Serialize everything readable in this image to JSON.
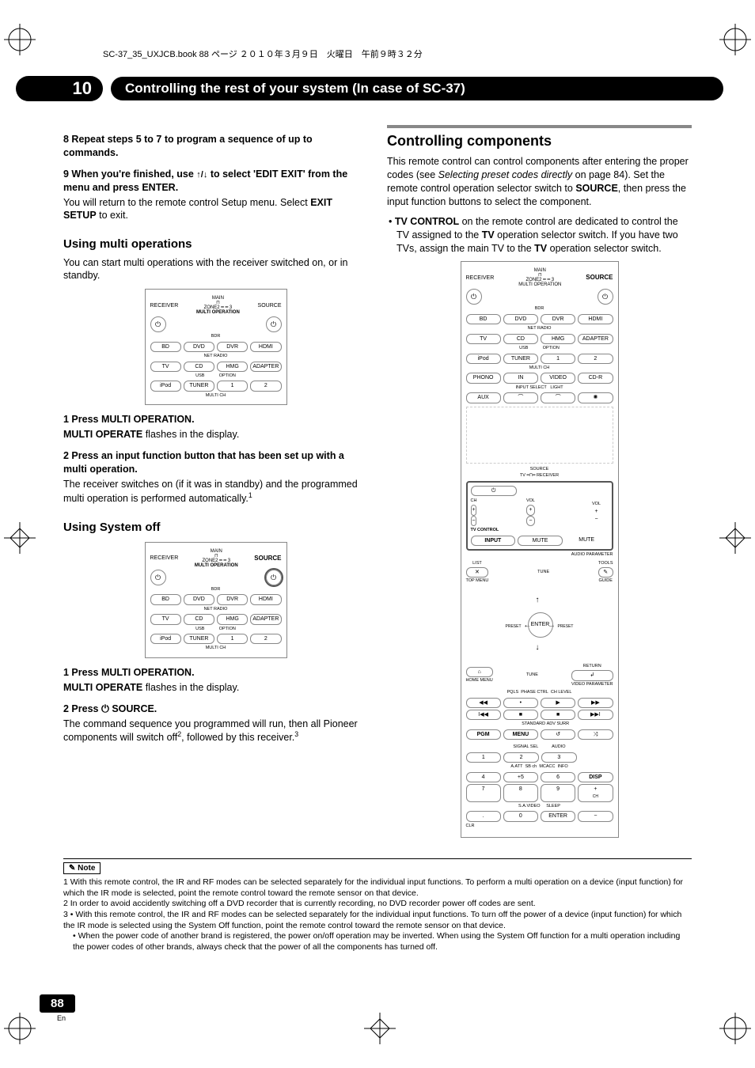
{
  "header": "SC-37_35_UXJCB.book  88 ページ  ２０１０年３月９日　火曜日　午前９時３２分",
  "chapter_num": "10",
  "chapter_title": "Controlling the rest of your system (In case of SC-37)",
  "col1": {
    "step8": "8   Repeat steps 5 to 7 to program a sequence of up to commands.",
    "step9_a": "9   When you're finished, use ",
    "step9_b": " to select 'EDIT EXIT' from the menu and press ENTER.",
    "step9_body_a": "You will return to the remote control Setup menu. Select ",
    "step9_body_b": "EXIT SETUP",
    "step9_body_c": " to exit.",
    "h_multi": "Using multi operations",
    "multi_body": "You can start multi operations with the receiver switched on, or in standby.",
    "multi_s1": "1   Press MULTI OPERATION.",
    "multi_s1_body_a": "MULTI OPERATE",
    "multi_s1_body_b": " flashes in the display.",
    "multi_s2": "2   Press an input function button that has been set up with a multi operation.",
    "multi_s2_body": "The receiver switches on (if it was in standby) and the programmed multi operation is performed automatically.",
    "h_sysoff": "Using System off",
    "sys_s1": "1   Press MULTI OPERATION.",
    "sys_s1_body_a": "MULTI OPERATE",
    "sys_s1_body_b": " flashes in the display.",
    "sys_s2_a": "2   Press ",
    "sys_s2_b": " SOURCE.",
    "sys_s2_body_a": "The command sequence you programmed will run, then all Pioneer components will switch off",
    "sys_s2_body_b": ", followed by this receiver."
  },
  "col2": {
    "h_main": "Controlling components",
    "intro_a": "This remote control can control components after entering the proper codes (see ",
    "intro_i": "Selecting preset codes directly",
    "intro_b": " on page 84). Set the remote control operation selector switch to ",
    "intro_bold": "SOURCE",
    "intro_c": ", then press the input function buttons to select the component.",
    "bullet_a": "TV CONTROL",
    "bullet_b": " on the remote control are dedicated to control the TV assigned to the ",
    "bullet_c": "TV",
    "bullet_d": " operation selector switch. If you have two TVs, assign the main TV to the ",
    "bullet_e": "TV",
    "bullet_f": " operation selector switch."
  },
  "remote": {
    "receiver": "RECEIVER",
    "main": "MAIN",
    "source": "SOURCE",
    "zone2": "ZONE2",
    "multi_op": "MULTI OPERATION",
    "bdr": "BDR",
    "row1": [
      "BD",
      "DVD",
      "DVR",
      "HDMI"
    ],
    "netradio": "NET RADIO",
    "row2": [
      "TV",
      "CD",
      "HMG",
      "ADAPTER"
    ],
    "usb": "USB",
    "option": "OPTION",
    "row3": [
      "iPod",
      "TUNER",
      "1",
      "2"
    ],
    "multich": "MULTI CH",
    "row4": [
      "PHONO",
      "IN",
      "VIDEO",
      "CD-R"
    ],
    "inputselect": "INPUT SELECT",
    "light": "LIGHT",
    "row5_a": "AUX",
    "row5_d": "✺",
    "tv": "TV",
    "ch": "CH",
    "vol": "VOL",
    "tvcontrol": "TV CONTROL",
    "input": "INPUT",
    "mute": "MUTE",
    "list": "LIST",
    "tune": "TUNE",
    "tools": "TOOLS",
    "guide": "GUIDE",
    "topmenu": "TOP MENU",
    "preset": "PRESET",
    "enter": "ENTER",
    "return": "RETURN",
    "home": "HOME MENU",
    "pqls": "PQLS",
    "phasectrl": "PHASE CTRL",
    "chlevel": "CH LEVEL",
    "info": "INFO",
    "disp": "DISP",
    "pgm": "PGM",
    "menu": "MENU",
    "standard": "STANDARD",
    "advsurr": "ADV SURR",
    "audio": "AUDIO",
    "signalsel": "SIGNAL SEL",
    "aatt": "A.ATT",
    "sba": "SB ch",
    "mcacc": "MCACC",
    "savideo": "S.A.VIDEO",
    "sleep": "SLEEP",
    "numpad": [
      "1",
      "2",
      "3",
      "4",
      "+5",
      "6",
      "7",
      "8",
      "9",
      ".",
      "0",
      "ENTER"
    ],
    "clr": "CLR",
    "audio_p": "AUDIO PARAMETER",
    "video_p": "VIDEO PARAMETER"
  },
  "note": {
    "label": "Note",
    "n1": "1 With this remote control, the IR and RF modes can be selected separately for the individual input functions. To perform a multi operation on a device (input function) for which the IR mode is selected, point the remote control toward the remote sensor on that device.",
    "n2": "2 In order to avoid accidently switching off a DVD recorder that is currently recording, no DVD recorder power off codes are sent.",
    "n3a": "3 • With this remote control, the IR and RF modes can be selected separately for the individual input functions. To turn off the power of a device (input function) for which the IR mode is selected using the System Off function, point the remote control toward the remote sensor on that device.",
    "n3b": "• When the power code of another brand is registered, the power on/off operation may be inverted. When using the System Off function for a multi operation including the power codes of other brands, always check that the power of all the components has turned off."
  },
  "page_num": "88",
  "page_lang": "En"
}
